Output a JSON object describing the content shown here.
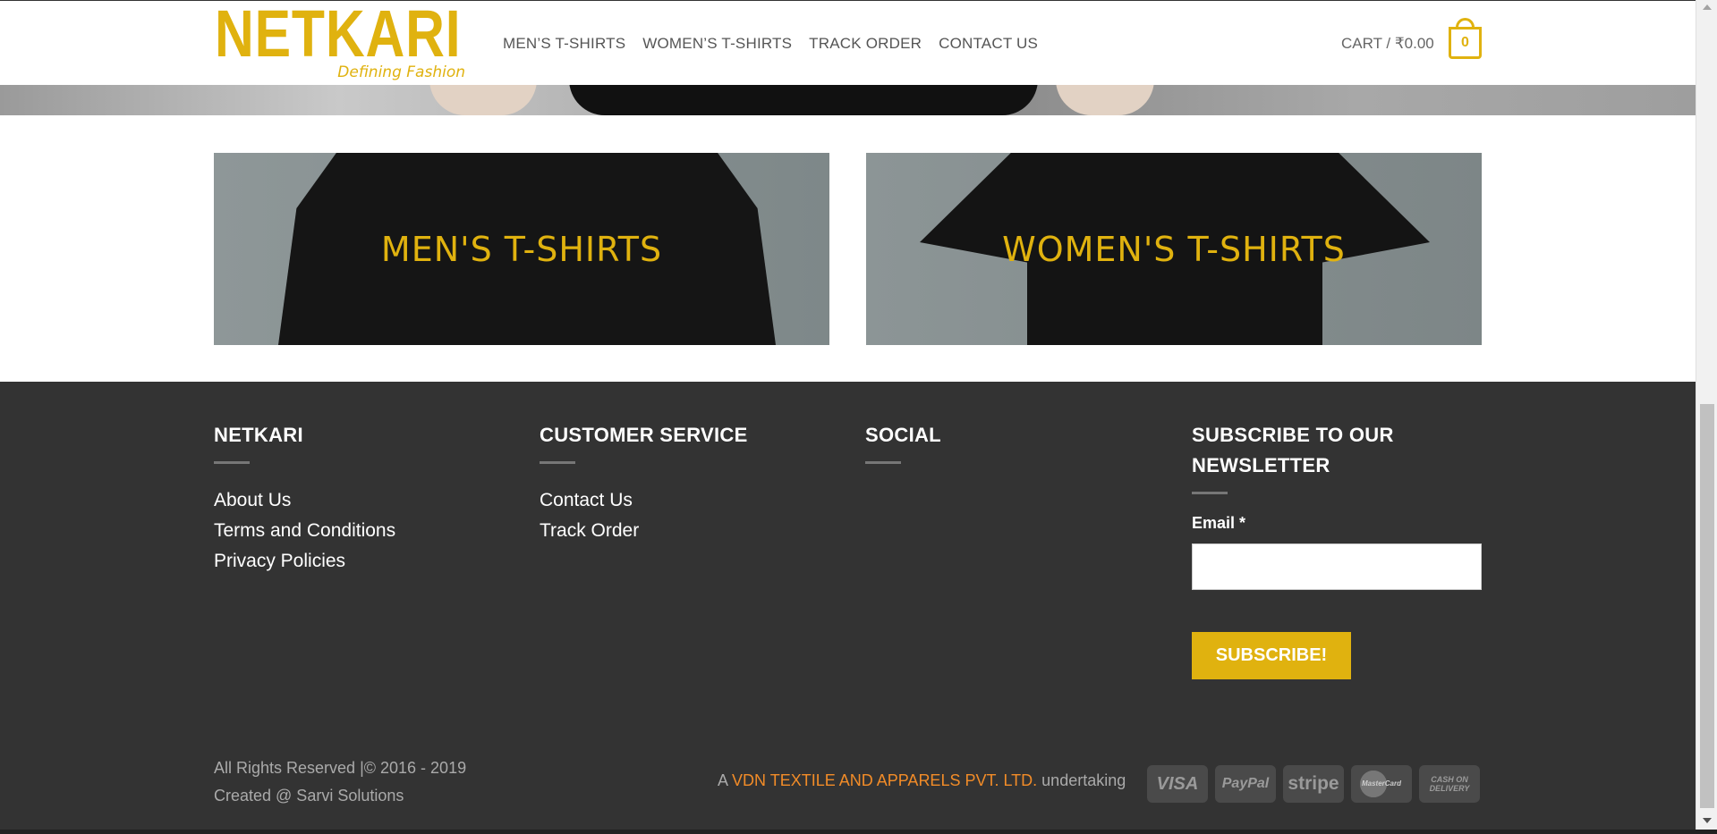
{
  "header": {
    "logo_text": "NETKARI",
    "logo_tagline": "Defining Fashion",
    "nav": [
      {
        "label": "MEN’S T-SHIRTS"
      },
      {
        "label": "WOMEN’S T-SHIRTS"
      },
      {
        "label": "TRACK ORDER"
      },
      {
        "label": "CONTACT US"
      }
    ],
    "cart_label": "CART / ₹0.00",
    "cart_count": "0"
  },
  "banners": {
    "men_label": "MEN'S T-SHIRTS",
    "women_label": "WOMEN'S T-SHIRTS"
  },
  "footer": {
    "col1": {
      "title": "NETKARI",
      "links": [
        "About Us",
        "Terms and Conditions",
        "Privacy Policies"
      ]
    },
    "col2": {
      "title": "CUSTOMER SERVICE",
      "links": [
        "Contact Us",
        "Track Order"
      ]
    },
    "col3": {
      "title": "SOCIAL"
    },
    "col4": {
      "title": "SUBSCRIBE TO OUR NEWSLETTER",
      "email_label": "Email *",
      "email_value": "",
      "button": "SUBSCRIBE!"
    },
    "copyright": "All Rights Reserved |© 2016 - 2019",
    "created": "Created @ Sarvi Solutions",
    "company_prefix": "A",
    "company_link": "VDN TEXTILE AND APPARELS PVT. LTD.",
    "company_suffix": "undertaking",
    "payments": [
      "VISA",
      "PayPal",
      "stripe",
      "MasterCard",
      "CASH ON DELIVERY"
    ]
  },
  "colors": {
    "brand_yellow": "#e0b20f",
    "footer_bg": "#333333",
    "link_orange": "#f28c28"
  }
}
